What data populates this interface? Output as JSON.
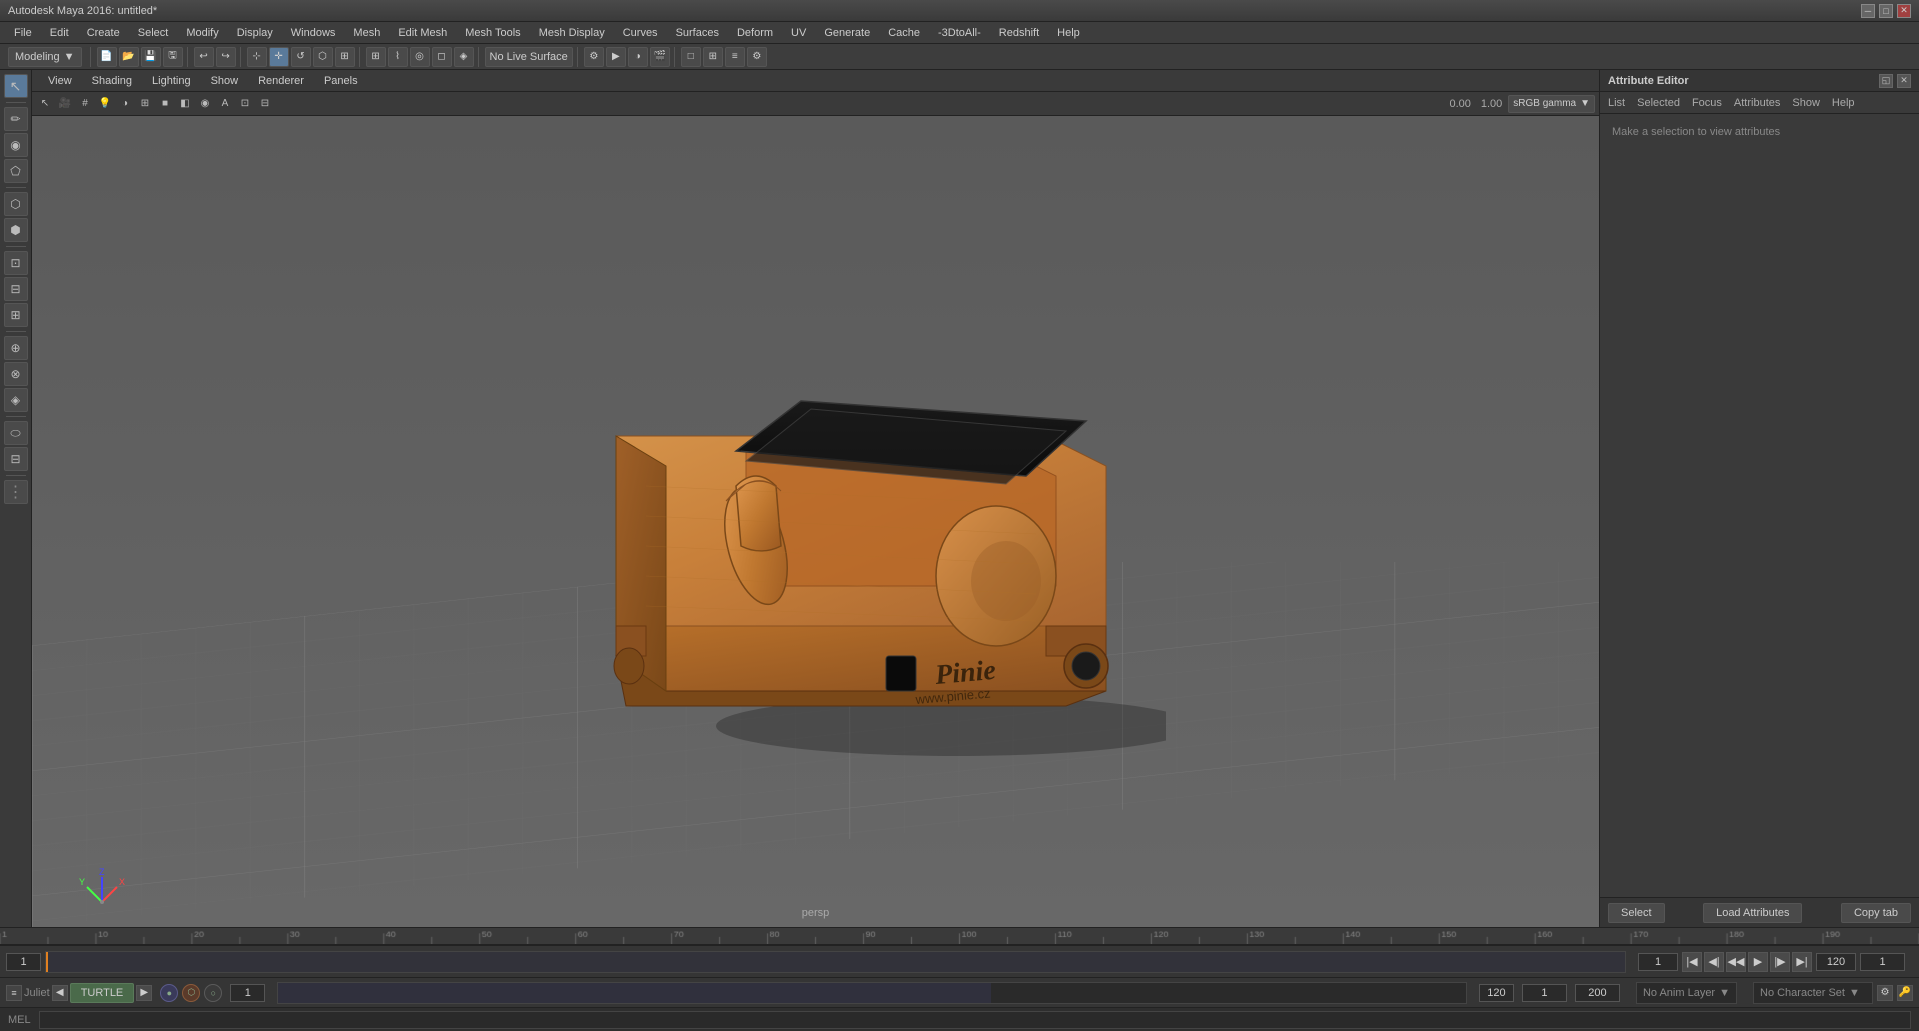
{
  "title_bar": {
    "title": "Autodesk Maya 2016: untitled*",
    "controls": [
      "minimize",
      "maximize",
      "close"
    ]
  },
  "menu_bar": {
    "items": [
      "File",
      "Edit",
      "Create",
      "Select",
      "Modify",
      "Display",
      "Windows",
      "Mesh",
      "Edit Mesh",
      "Mesh Tools",
      "Mesh Display",
      "Curves",
      "Surfaces",
      "Deform",
      "UV",
      "Generate",
      "Cache",
      "-3DtoAll-",
      "Redshift",
      "Help"
    ]
  },
  "toolbar": {
    "modeling_mode": "Modeling",
    "live_surface_label": "No Live Surface",
    "color_space": "sRGB gamma"
  },
  "viewport": {
    "menu_items": [
      "View",
      "Shading",
      "Lighting",
      "Show",
      "Renderer",
      "Panels"
    ],
    "camera": "persp",
    "x_value": "0.00",
    "y_value": "1.00"
  },
  "attribute_editor": {
    "title": "Attribute Editor",
    "tabs": [
      "List",
      "Selected",
      "Focus",
      "Attributes",
      "Show",
      "Help"
    ],
    "message": "Make a selection to view attributes",
    "footer": {
      "select_label": "Select",
      "load_label": "Load Attributes",
      "copy_label": "Copy tab"
    }
  },
  "timeline": {
    "start_frame": "1",
    "current_frame": "1",
    "end_frame_range": "120",
    "end_frame_total": "200",
    "start_range": "1",
    "end_range": "120"
  },
  "transport": {
    "buttons": [
      "skip_back",
      "prev_key",
      "back",
      "play_back",
      "play",
      "forward",
      "next_key",
      "skip_forward"
    ],
    "current_time": "1"
  },
  "layer_bar": {
    "layer_name": "Juliet",
    "tab_label": "TURTLE",
    "anim_layer": "No Anim Layer",
    "character_set": "No Character Set",
    "range_start": "1",
    "range_end": "120",
    "total_start": "1",
    "total_end": "200"
  },
  "status_bar": {
    "mode": "MEL"
  }
}
